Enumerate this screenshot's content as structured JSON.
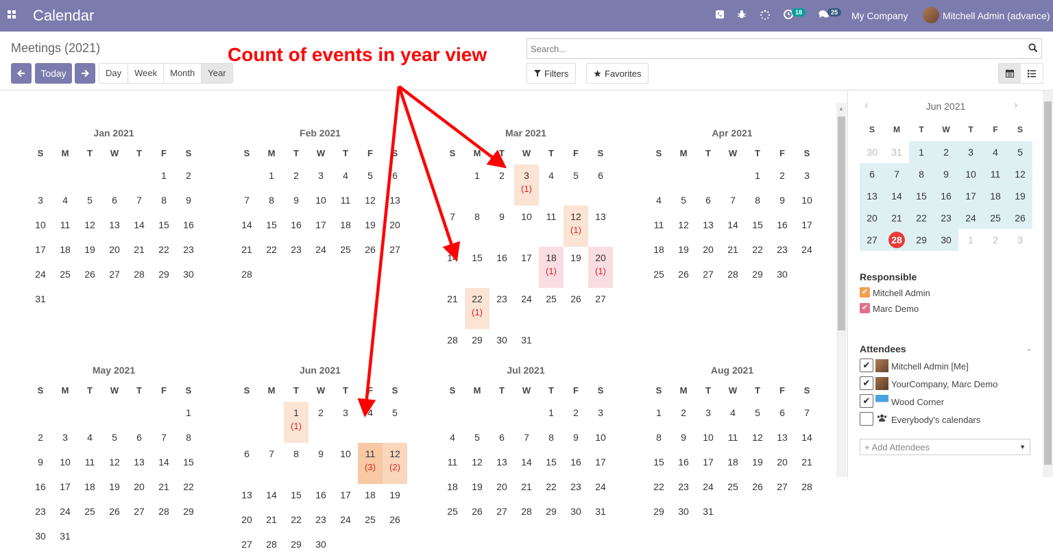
{
  "app_title": "Calendar",
  "topbar": {
    "activity_count": "18",
    "messages_count": "25",
    "company": "My Company",
    "user": "Mitchell Admin (advance)"
  },
  "breadcrumb": "Meetings (2021)",
  "nav": {
    "today": "Today"
  },
  "scales": [
    "Day",
    "Week",
    "Month",
    "Year"
  ],
  "active_scale": "Year",
  "search": {
    "placeholder": "Search..."
  },
  "filters_label": "Filters",
  "favorites_label": "Favorites",
  "annotation": "Count of events in year view",
  "weekday_letters": [
    "S",
    "M",
    "T",
    "W",
    "T",
    "F",
    "S"
  ],
  "months": [
    {
      "title": "Jan 2021",
      "start": 5,
      "days": 31,
      "events": {}
    },
    {
      "title": "Feb 2021",
      "start": 1,
      "days": 28,
      "events": {}
    },
    {
      "title": "Mar 2021",
      "start": 1,
      "days": 31,
      "events": {
        "3": "(1)",
        "12": "(1)",
        "18": "(1)",
        "20": "(1)",
        "22": "(1)"
      }
    },
    {
      "title": "Apr 2021",
      "start": 4,
      "days": 30,
      "events": {}
    },
    {
      "title": "May 2021",
      "start": 6,
      "days": 31,
      "events": {}
    },
    {
      "title": "Jun 2021",
      "start": 2,
      "days": 30,
      "events": {
        "1": "(1)",
        "11": "(3)",
        "12": "(2)"
      }
    },
    {
      "title": "Jul 2021",
      "start": 4,
      "days": 31,
      "events": {}
    },
    {
      "title": "Aug 2021",
      "start": 0,
      "days": 31,
      "events": {}
    }
  ],
  "mini_calendar": {
    "title": "Jun 2021",
    "weeks": [
      [
        "30",
        "31",
        "1",
        "2",
        "3",
        "4",
        "5"
      ],
      [
        "6",
        "7",
        "8",
        "9",
        "10",
        "11",
        "12"
      ],
      [
        "13",
        "14",
        "15",
        "16",
        "17",
        "18",
        "19"
      ],
      [
        "20",
        "21",
        "22",
        "23",
        "24",
        "25",
        "26"
      ],
      [
        "27",
        "28",
        "29",
        "30",
        "1",
        "2",
        "3"
      ]
    ],
    "today": "28"
  },
  "responsible": {
    "title": "Responsible",
    "items": [
      {
        "label": "Mitchell Admin",
        "color": "#f0a050"
      },
      {
        "label": "Marc Demo",
        "color": "#e0708a"
      }
    ]
  },
  "attendees": {
    "title": "Attendees",
    "items": [
      {
        "label": "Mitchell Admin [Me]",
        "checked": true
      },
      {
        "label": "YourCompany, Marc Demo",
        "checked": true
      },
      {
        "label": "Wood Corner",
        "checked": true
      },
      {
        "label": "Everybody's calendars",
        "checked": false
      }
    ],
    "add_placeholder": "+ Add Attendees"
  }
}
